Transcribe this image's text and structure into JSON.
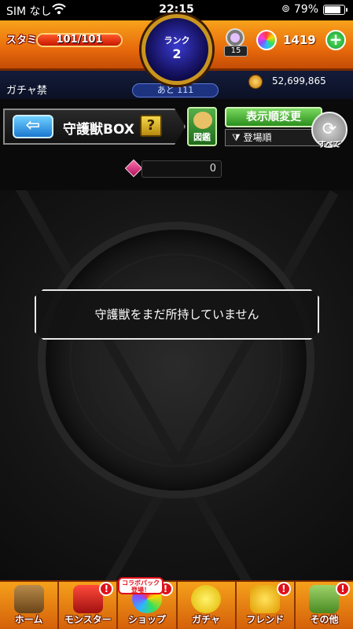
{
  "status_bar": {
    "carrier": "SIM なし",
    "time": "22:15",
    "battery": "79%"
  },
  "header": {
    "stamina_label": "スタミナ",
    "stamina_value": "101/101",
    "stamina_fraction": 1.0,
    "rank_label": "ランク",
    "rank_value": "2",
    "gem_count": "15",
    "orb_count": "1419",
    "plus_label": "+"
  },
  "info": {
    "gacha_ban": "ガチャ禁",
    "next_rank": "あと 111",
    "coins": "52,699,865"
  },
  "box_header": {
    "back_label": "⇦",
    "title": "守護獣BOX",
    "help_label": "?",
    "zukan_label": "図鑑",
    "sort_button": "表示順変更",
    "sort_current": "登場順",
    "all_label": "すべて"
  },
  "count": {
    "value": "0"
  },
  "main": {
    "empty_message": "守護獣をまだ所持していません"
  },
  "collab_tag": "コラボパック登場！",
  "nav": {
    "items": [
      {
        "label": "ホーム",
        "icon": "home-icon",
        "badge": ""
      },
      {
        "label": "モンスター",
        "icon": "monster-icon",
        "badge": "!"
      },
      {
        "label": "ショップ",
        "icon": "shop-icon",
        "badge": "!"
      },
      {
        "label": "ガチャ",
        "icon": "gacha-icon",
        "badge": ""
      },
      {
        "label": "フレンド",
        "icon": "friend-icon",
        "badge": "!"
      },
      {
        "label": "その他",
        "icon": "other-icon",
        "badge": "!"
      }
    ]
  },
  "colors": {
    "header_orange": "#e86a0c",
    "accent_green": "#2a8f1c",
    "badge_red": "#e0101a"
  }
}
